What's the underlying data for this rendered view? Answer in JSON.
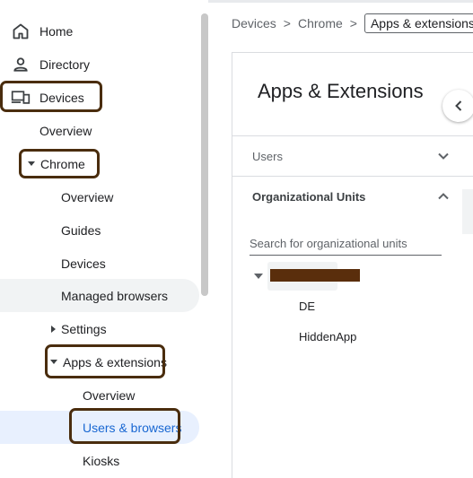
{
  "sidebar": {
    "home": "Home",
    "directory": "Directory",
    "devices": "Devices",
    "devices_overview": "Overview",
    "chrome": "Chrome",
    "chrome_overview": "Overview",
    "guides": "Guides",
    "chrome_devices": "Devices",
    "managed_browsers": "Managed browsers",
    "settings": "Settings",
    "apps_extensions": "Apps & extensions",
    "apps_overview": "Overview",
    "users_browsers": "Users & browsers",
    "kiosks": "Kiosks"
  },
  "breadcrumb": {
    "devices": "Devices",
    "chrome": "Chrome",
    "current": "Apps & extensions",
    "separator": ">"
  },
  "main": {
    "title": "Apps & Extensions",
    "users_section": "Users",
    "org_units_section": "Organizational Units",
    "search_placeholder": "Search for organizational units",
    "org_units": [
      "DE",
      "HiddenApp"
    ]
  },
  "colors": {
    "highlight_border": "#4a2d0e",
    "redaction": "#5a2e0c",
    "active_text": "#1967d2",
    "active_bg": "#e8f0fe"
  }
}
